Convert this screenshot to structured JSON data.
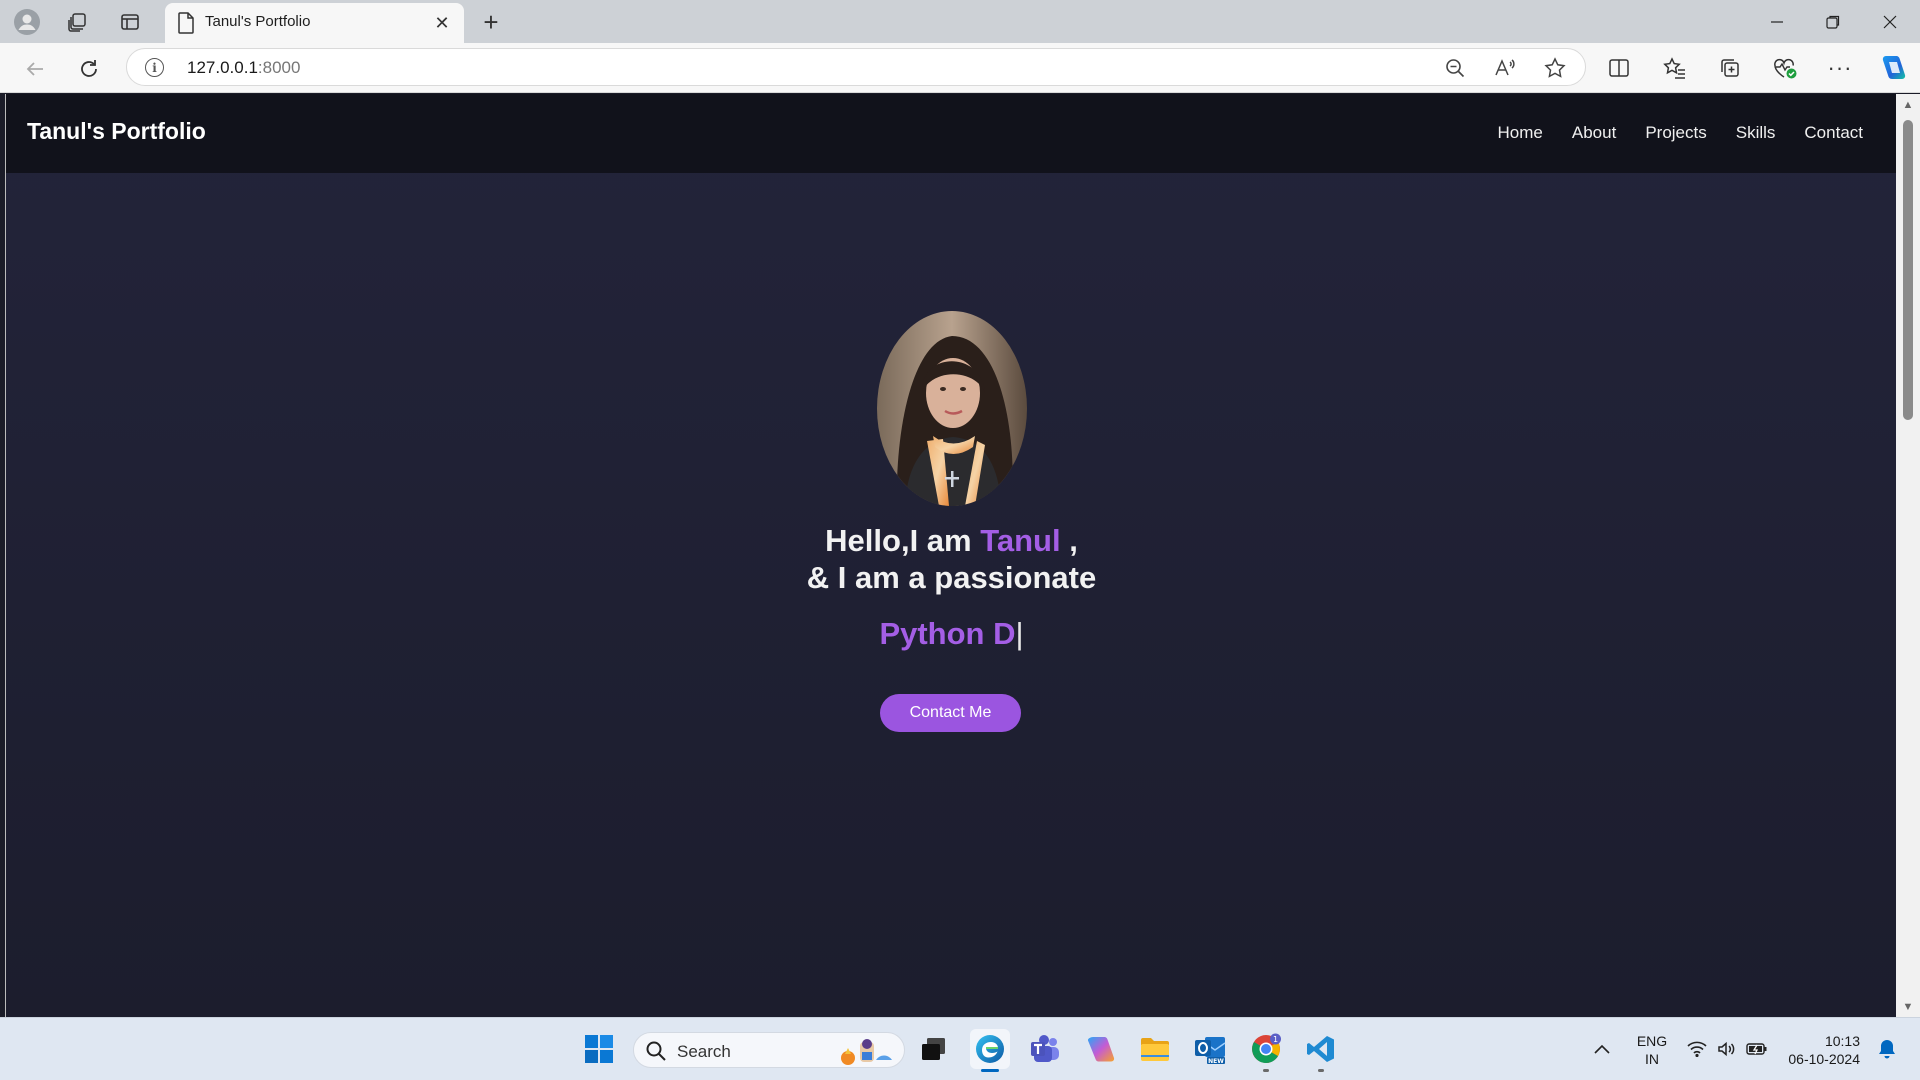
{
  "browser": {
    "tab_title": "Tanul's Portfolio",
    "url_host": "127.0.0.1",
    "url_port": ":8000"
  },
  "site": {
    "brand": "Tanul's Portfolio",
    "nav": [
      "Home",
      "About",
      "Projects",
      "Skills",
      "Contact"
    ],
    "hero": {
      "line1_prefix": "Hello,I am ",
      "name": "Tanul",
      "line1_suffix": " ,",
      "line2": "& I am a passionate",
      "typed_text": "Python D",
      "caret": "|",
      "cta_label": "Contact Me"
    },
    "colors": {
      "accent": "#a45ee5",
      "nav_bg": "#11121b",
      "page_bg": "#1f2033"
    }
  },
  "taskbar": {
    "search_label": "Search",
    "language": "ENG",
    "region": "IN",
    "time": "10:13",
    "date": "06-10-2024",
    "chrome_badge": "1"
  }
}
